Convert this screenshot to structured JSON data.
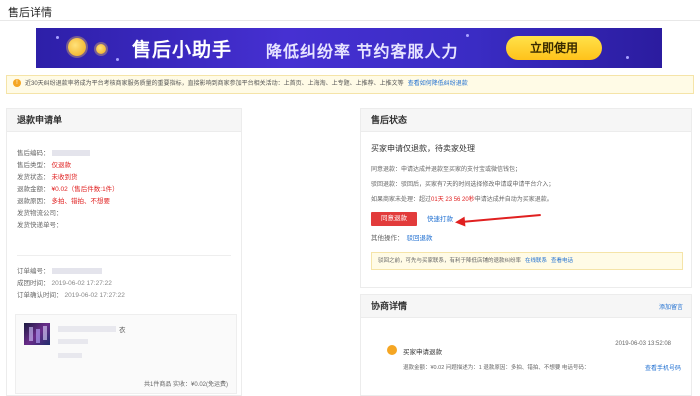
{
  "page": {
    "title": "售后详情"
  },
  "banner": {
    "title": "售后小助手",
    "slogan": "降低纠纷率 节约客服人力",
    "button": "立即使用"
  },
  "notice": {
    "text": "近30天纠纷退款率将成为平台考核商家服务质量的重要指标，直接影响到商家参加平台相关活动：上首页、上海淘、上专题、上推荐、上推文等",
    "link": "查看如何降低纠纷退款"
  },
  "refund_form": {
    "header": "退款申请单",
    "rows": [
      {
        "label": "售后编码：",
        "value": "",
        "style": "blur"
      },
      {
        "label": "售后类型：",
        "value": "仅退款",
        "style": "red"
      },
      {
        "label": "发货状态：",
        "value": "未收到货",
        "style": "red"
      },
      {
        "label": "退款金额：",
        "value": "¥0.02（售后件数:1件）",
        "style": "red"
      },
      {
        "label": "退款原因：",
        "value": "多拍、错拍、不想要",
        "style": "red"
      },
      {
        "label": "发货物流公司：",
        "value": "",
        "style": "plain"
      },
      {
        "label": "发货快递单号：",
        "value": "",
        "style": "plain"
      }
    ],
    "order_rows": [
      {
        "label": "订单编号：",
        "value": "",
        "style": "blur"
      },
      {
        "label": "成团时间：",
        "value": "2019-06-02 17:27:22",
        "style": "plain"
      },
      {
        "label": "订单确认时间：",
        "value": "2019-06-02 17:27:22",
        "style": "plain"
      }
    ],
    "product": {
      "name_suffix": "衣",
      "summary": "共1件商品  实收：¥0.02(免运费)"
    }
  },
  "after_sale_status": {
    "header": "售后状态",
    "status": "买家申请仅退款，待卖家处理",
    "lines": [
      {
        "label": "同意退款：",
        "text": "申请达成并退款至买家的支付宝或微信钱包；"
      },
      {
        "label": "驳回退款：",
        "text": "驳回后，买家有7天的时间选择修改申请或申请平台介入；"
      }
    ],
    "deadline": {
      "prefix": "如果商家未处理：超过",
      "countdown": "01天 23  56  20秒",
      "suffix": "申请达成并自动为买家退款。"
    },
    "agree_button": "同意退款",
    "quick_link": "快速打款",
    "other_ops_label": "其他操作：",
    "other_ops_link": "驳回退款",
    "tip": {
      "text": "驳回之前，可先与买家联系，有利于降低店铺的退款纠纷率",
      "link1": "在线联系",
      "link2": "查看电话"
    }
  },
  "negotiation": {
    "header": "协商详情",
    "add_note": "添加留言",
    "time": "2019-06-03 13:52:08",
    "title": "买家申请退款",
    "detail": "退款金额：¥0.02  问题描述为：1  退款原因：多拍、错拍、不想要  电话号码：",
    "link": "查看手机号码"
  },
  "colors": {
    "accent_red": "#e02020",
    "link_blue": "#1f6fd1",
    "banner_purple": "#3a2cc4"
  }
}
